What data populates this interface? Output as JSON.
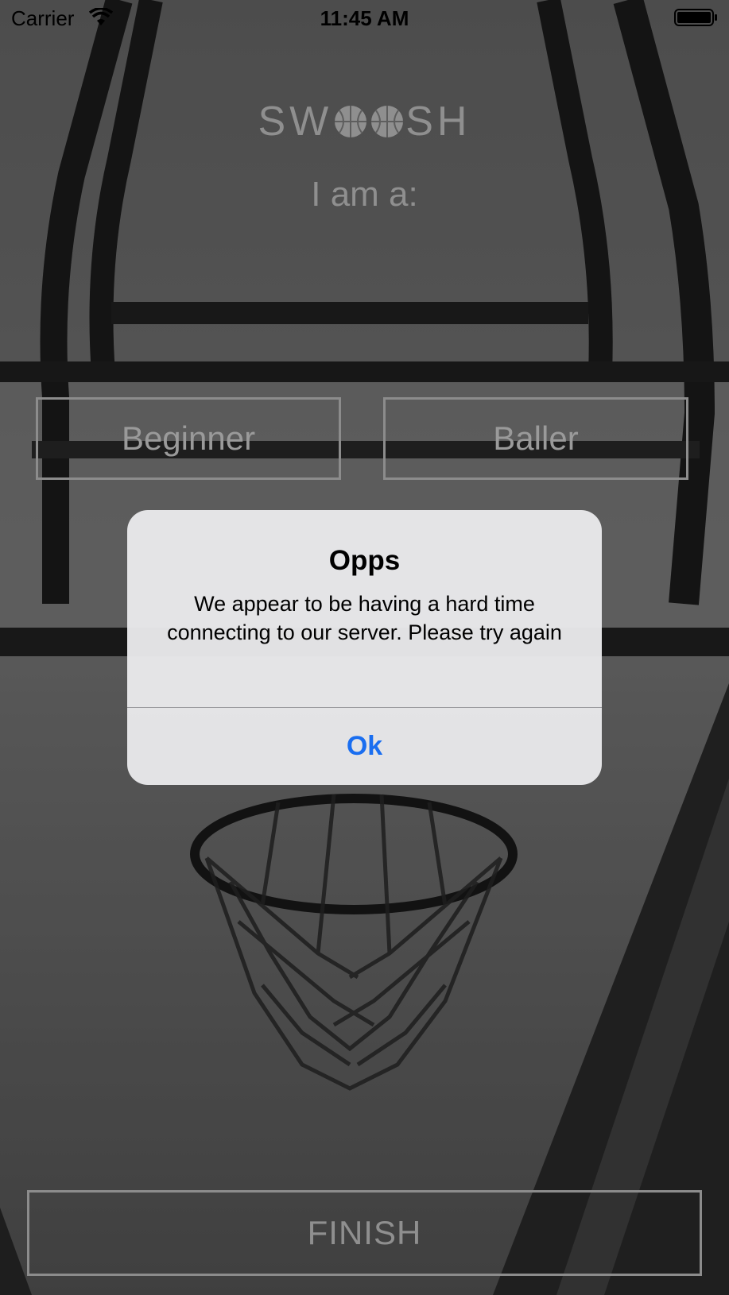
{
  "status_bar": {
    "carrier": "Carrier",
    "time": "11:45 AM",
    "wifi_icon": "wifi-icon",
    "battery_icon": "battery-icon"
  },
  "app": {
    "logo_prefix": "SW",
    "logo_suffix": "SH",
    "logo_icon": "basketball-icon",
    "subtitle": "I am a:",
    "options": [
      {
        "label": "Beginner"
      },
      {
        "label": "Baller"
      }
    ],
    "finish_label": "FINISH"
  },
  "alert": {
    "title": "Opps",
    "message": "We appear to be having a hard time connecting to our server. Please try again",
    "ok_label": "Ok"
  },
  "colors": {
    "alert_button": "#1a6ef0",
    "muted_text": "#8f8f8f",
    "button_border": "#8c8c8c"
  }
}
